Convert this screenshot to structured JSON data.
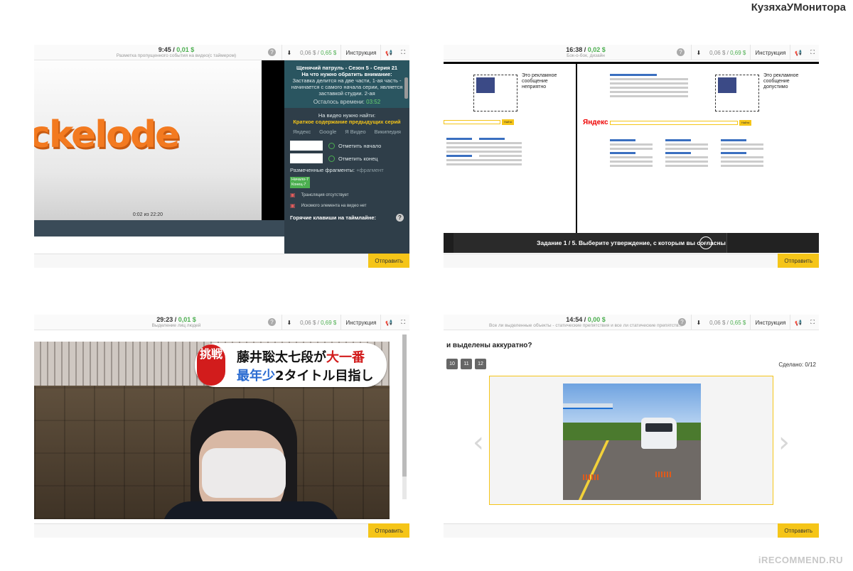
{
  "watermark": {
    "site_label": "КузяхаУМонитора",
    "footer_logo": "iRECOMMEND.RU"
  },
  "common": {
    "instruction_label": "Инструкция",
    "submit_label": "Отправить"
  },
  "panel1": {
    "timer": "9:45",
    "earned": "0,01 $",
    "subtitle": "Разметка пропущенного события на видео(с таймером)",
    "money_a": "0,06 $",
    "money_b": "0,65 $",
    "series_title": "Щенячий патруль - Сезон 5 - Серия 21",
    "attention": "На что нужно обратить внимание:",
    "attention_text": "Заставка делится на две части, 1-ая часть - начинается с самого начала серии, является заставкой студии. 2-ая",
    "time_left_label": "Осталось времени:",
    "time_left": "03:52",
    "find_label": "На видео нужно найти:",
    "find_value": "Краткое содержание предыдущих серий",
    "search_links": [
      "Яндекс",
      "Google",
      "Я Видео",
      "Википедия"
    ],
    "mark_start": "Отметить начало",
    "mark_end": "Отметить конец",
    "fragments_label": "Размеченные фрагменты:",
    "fragments_hint": "+фрагмент",
    "fragment_tag_1": "Начало-7",
    "fragment_tag_2": "Конец-7",
    "warn1": "Трансляция отсутствует",
    "warn2": "Искомого элемента на видео нет",
    "hotkeys": "Горячие клавиши на таймлайне:",
    "video_time": "0:02 из 22:20",
    "video_logo": "ckelode"
  },
  "panel2": {
    "timer": "16:38",
    "earned": "0,02 $",
    "subtitle": "Бок-о-бок, дизайн",
    "money_a": "0,06 $",
    "money_b": "0,69 $",
    "ad_left": "Это рекламное сообщение неприятно",
    "ad_right": "Это рекламное сообщение допустимо",
    "yandex_logo": "Яндекс",
    "find_btn_1": "Найти",
    "find_btn_2": "Найти",
    "task": "Задание 1 / 5. Выберите утверждение, с которым вы согласны"
  },
  "panel3": {
    "timer": "29:23",
    "earned": "0,01 $",
    "subtitle": "Выделение лиц людей",
    "money_a": "0,06 $",
    "money_b": "0,69 $",
    "jp_badge": "挑戦",
    "jp_line1_a": "藤井聡太七段が",
    "jp_line1_b": "大一番",
    "jp_line2_a": "最年少",
    "jp_line2_b": "2タイトル目指し"
  },
  "panel4": {
    "timer": "14:54",
    "earned": "0,00 $",
    "subtitle": "Все ли выделенные объекты - статические препятствия и все ли статические препятств...",
    "money_a": "0,06 $",
    "money_b": "0,65 $",
    "question": "и выделены аккуратно?",
    "pages": [
      "10",
      "11",
      "12"
    ],
    "done": "Сделано: 0/12"
  }
}
